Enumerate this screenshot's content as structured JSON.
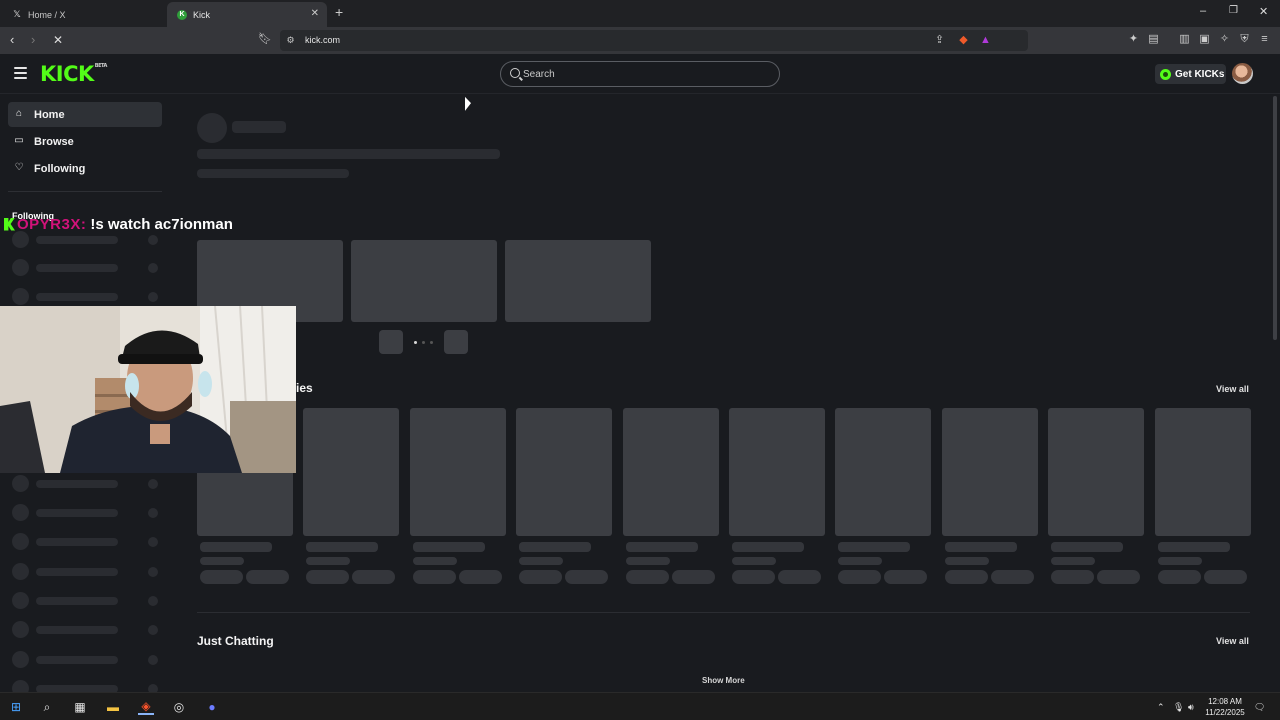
{
  "browser": {
    "tabs": [
      {
        "title": "Home / X",
        "icon": "x-logo-icon"
      },
      {
        "title": "Kick",
        "icon": "kick-favicon-icon"
      }
    ],
    "url": "kick.com"
  },
  "header": {
    "logo": "KICK",
    "logo_badge": "BETA",
    "search_placeholder": "Search",
    "get_kicks_label": "Get KICKs"
  },
  "sidebar": {
    "nav": [
      {
        "label": "Home",
        "icon": "home-icon",
        "active": true
      },
      {
        "label": "Browse",
        "icon": "browse-icon",
        "active": false
      },
      {
        "label": "Following",
        "icon": "heart-icon",
        "active": false
      }
    ],
    "following_heading": "Following"
  },
  "chat_overlay": {
    "username": "OPYR3X:",
    "message": "!s watch ac7ionman"
  },
  "main": {
    "categories_title_partial": "ies",
    "view_all_label": "View all",
    "just_chatting_title": "Just Chatting",
    "show_more_label": "Show More"
  },
  "taskbar": {
    "time": "12:08 AM",
    "date": "11/22/2025"
  },
  "colors": {
    "brand": "#53fc18",
    "background": "#191b1f",
    "skeleton": "#3c3e43",
    "chat_user": "#d1127a"
  }
}
